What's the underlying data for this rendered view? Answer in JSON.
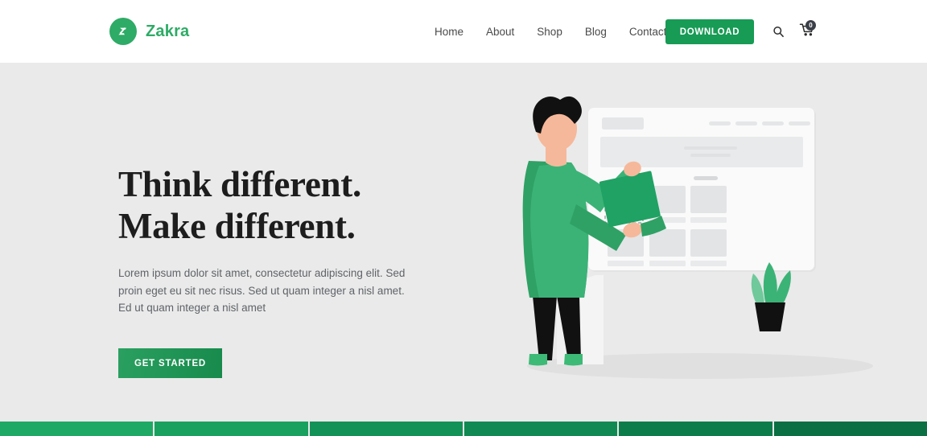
{
  "header": {
    "brand": {
      "name": "Zakra",
      "logo_icon": "zakra-logo-icon",
      "color": "#2eab66"
    },
    "nav": [
      {
        "label": "Home"
      },
      {
        "label": "About"
      },
      {
        "label": "Shop"
      },
      {
        "label": "Blog"
      },
      {
        "label": "Contact"
      }
    ],
    "download_label": "DOWNLOAD",
    "search_icon": "search-icon",
    "cart_icon": "shopping-cart-icon",
    "cart_count": "0",
    "button_color": "#179b55"
  },
  "hero": {
    "title_line1": "Think different.",
    "title_line2": "Make different.",
    "description": "Lorem ipsum dolor sit amet, consectetur adipiscing elit. Sed proin eget eu sit nec risus. Sed ut quam integer a nisl amet.  Ed ut quam integer a nisl amet",
    "cta_label": "GET STARTED",
    "background": "#eaeaea",
    "illustration_name": "person-dragging-tile-illustration"
  },
  "bottom_strip": {
    "segments": [
      {
        "color": "#1ea964"
      },
      {
        "color": "#19a15f"
      },
      {
        "color": "#139257"
      },
      {
        "color": "#108a52"
      },
      {
        "color": "#0c7d4a"
      },
      {
        "color": "#0a6f42"
      }
    ]
  }
}
